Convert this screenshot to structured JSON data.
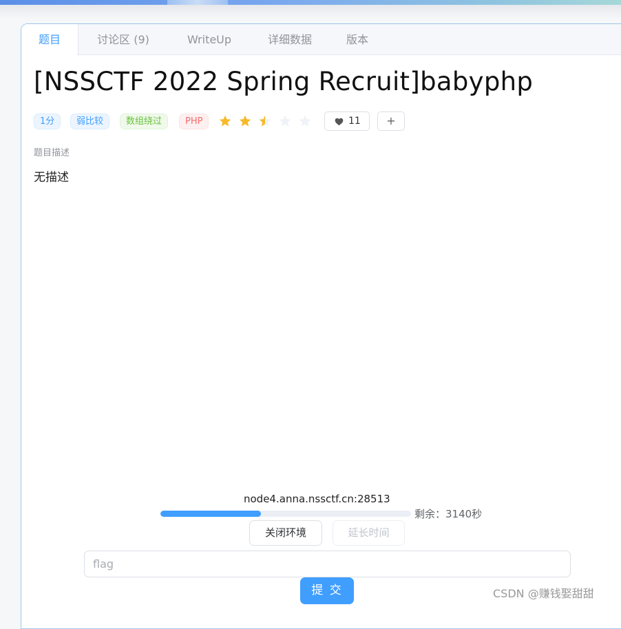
{
  "tabs": [
    {
      "label": "题目"
    },
    {
      "label": "讨论区 (9)"
    },
    {
      "label": "WriteUp"
    },
    {
      "label": "详细数据"
    },
    {
      "label": "版本"
    }
  ],
  "problem": {
    "title": "[NSSCTF 2022 Spring Recruit]babyphp",
    "tags": [
      "1分",
      "弱比较",
      "数组绕过",
      "PHP"
    ],
    "rating": 2.5,
    "rating_max": 5,
    "likes": "11",
    "add_label": "+",
    "description_label": "题目描述",
    "description": "无描述"
  },
  "environment": {
    "host": "node4.anna.nssctf.cn:28513",
    "progress": 0.4,
    "remaining": "剩余：3140秒",
    "close_label": "关闭环境",
    "extend_label": "延长时间"
  },
  "submit": {
    "placeholder": "flag",
    "value": "",
    "button_label": "提 交"
  },
  "watermark": "CSDN @赚钱娶甜甜",
  "colors": {
    "primary": "#409eff",
    "star": "#f7ba2a",
    "star_empty": "#eff2f7"
  }
}
